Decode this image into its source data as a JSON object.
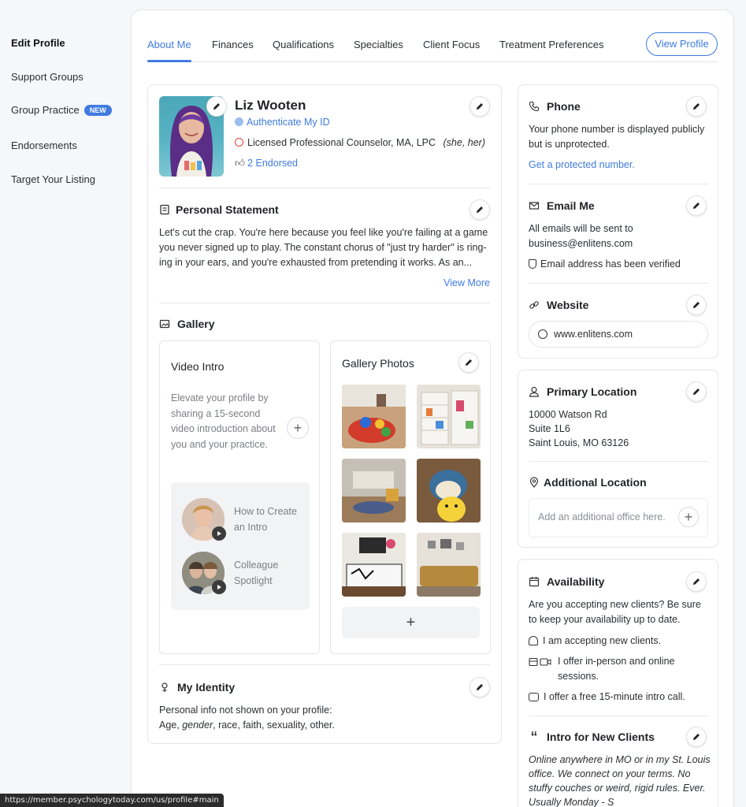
{
  "sidebar": {
    "items": [
      {
        "label": "Edit Profile"
      },
      {
        "label": "Support Groups"
      },
      {
        "label": "Group Practice",
        "badge": "NEW"
      },
      {
        "label": "Endorsements"
      },
      {
        "label": "Target Your Listing"
      }
    ]
  },
  "tabs": [
    {
      "label": "About Me"
    },
    {
      "label": "Finances"
    },
    {
      "label": "Qualifications"
    },
    {
      "label": "Specialties"
    },
    {
      "label": "Client Focus"
    },
    {
      "label": "Treatment Preferences"
    }
  ],
  "view_profile": "View Profile",
  "profile": {
    "name": "Liz Wooten",
    "authenticate": "Authenticate My ID",
    "credential": "Licensed Professional Counselor, MA, LPC",
    "pronouns": "(she, her)",
    "endorsed": "2 Endorsed"
  },
  "personal_statement": {
    "title": "Personal Statement",
    "text": "Let's cut the crap. You're here because you feel like you're failing at a game you never signed up to play. The constant chorus of \"just try harder\" is ring-ing in your ears, and you're exhausted from pretending it works. As an...",
    "view_more": "View More"
  },
  "gallery": {
    "title": "Gallery",
    "video_intro": {
      "title": "Video Intro",
      "text": "Elevate your profile by sharing a 15-second video introduction about you and your practice.",
      "examples": [
        {
          "label": "How to Create an Intro"
        },
        {
          "label": "Colleague Spotlight"
        }
      ]
    },
    "photos_title": "Gallery Photos"
  },
  "identity": {
    "title": "My Identity",
    "line1": "Personal info not shown on your profile:",
    "age": "Age, ",
    "gender": "gender",
    "rest": ", race, faith, sexuality, other."
  },
  "phone": {
    "title": "Phone",
    "text": "Your phone number is displayed publicly but is unprotected.",
    "link": "Get a protected number."
  },
  "email": {
    "title": "Email Me",
    "text1": "All emails will be sent to",
    "address": "business@enlitens.com",
    "verified": "Email address has been verified"
  },
  "website": {
    "title": "Website",
    "url": "www.enlitens.com"
  },
  "primary_location": {
    "title": "Primary Location",
    "line1": "10000 Watson Rd",
    "line2": "Suite 1L6",
    "line3": "Saint Louis, MO 63126"
  },
  "additional_location": {
    "title": "Additional Location",
    "placeholder": "Add an additional office here."
  },
  "availability": {
    "title": "Availability",
    "text": "Are you accepting new clients? Be sure to keep your availability up to date.",
    "accepting": "I am accepting new clients.",
    "offer": "I offer in-person and online sessions.",
    "intro_call": "I offer a free 15-minute intro call."
  },
  "intro_new_clients": {
    "title": "Intro for New Clients",
    "text": "Online anywhere in MO or in my St. Louis office. We connect on your terms. No stuffy couches or weird, rigid rules. Ever. Usually Monday - S"
  },
  "status_url": "https://member.psychologytoday.com/us/profile#main",
  "colors": {
    "accent": "#3f7be0",
    "border": "#e3e5e8"
  }
}
